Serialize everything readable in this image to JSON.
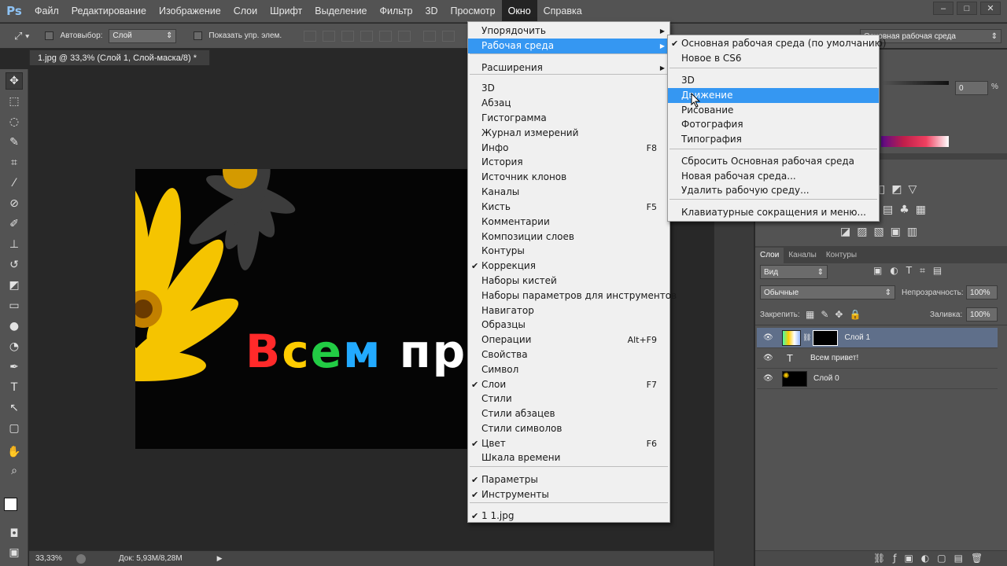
{
  "app": {
    "logo": "Ps"
  },
  "menubar": [
    "Файл",
    "Редактирование",
    "Изображение",
    "Слои",
    "Шрифт",
    "Выделение",
    "Фильтр",
    "3D",
    "Просмотр",
    "Окно",
    "Справка"
  ],
  "window_controls": [
    "–",
    "□",
    "✕"
  ],
  "options": {
    "autoselect_label": "Автовыбор:",
    "autoselect_value": "Слой",
    "show_controls_label": "Показать упр. элем.",
    "workspace_value": "Основная рабочая среда"
  },
  "document": {
    "tab_title": "1.jpg @ 33,3% (Слой 1, Слой-маска/8) *",
    "canvas_text": "Всем при",
    "zoom": "33,33%",
    "doc_size": "Док: 5,93M/8,28M"
  },
  "window_menu": {
    "items": [
      {
        "label": "Упорядочить",
        "submenu": true
      },
      {
        "label": "Рабочая среда",
        "submenu": true,
        "highlighted": true
      },
      {
        "label": "Расширения",
        "submenu": true
      },
      {
        "label": "3D"
      },
      {
        "label": "Абзац"
      },
      {
        "label": "Гистограмма"
      },
      {
        "label": "Журнал измерений"
      },
      {
        "label": "Инфо",
        "shortcut": "F8"
      },
      {
        "label": "История"
      },
      {
        "label": "Источник клонов"
      },
      {
        "label": "Каналы"
      },
      {
        "label": "Кисть",
        "shortcut": "F5"
      },
      {
        "label": "Комментарии"
      },
      {
        "label": "Композиции слоев"
      },
      {
        "label": "Контуры"
      },
      {
        "label": "Коррекция",
        "checked": true
      },
      {
        "label": "Наборы кистей"
      },
      {
        "label": "Наборы параметров для инструментов"
      },
      {
        "label": "Навигатор"
      },
      {
        "label": "Образцы"
      },
      {
        "label": "Операции",
        "shortcut": "Alt+F9"
      },
      {
        "label": "Свойства"
      },
      {
        "label": "Символ"
      },
      {
        "label": "Слои",
        "shortcut": "F7",
        "checked": true
      },
      {
        "label": "Стили"
      },
      {
        "label": "Стили абзацев"
      },
      {
        "label": "Стили символов"
      },
      {
        "label": "Цвет",
        "shortcut": "F6",
        "checked": true
      },
      {
        "label": "Шкала времени"
      },
      {
        "label": "Параметры",
        "checked": true
      },
      {
        "label": "Инструменты",
        "checked": true
      },
      {
        "label": "1 1.jpg",
        "checked": true
      }
    ]
  },
  "workspace_submenu": {
    "items": [
      {
        "label": "Основная рабочая среда (по умолчанию)",
        "checked": true
      },
      {
        "label": "Новое в CS6"
      },
      {
        "label": "3D"
      },
      {
        "label": "Движение",
        "highlighted": true
      },
      {
        "label": "Рисование"
      },
      {
        "label": "Фотография"
      },
      {
        "label": "Типография"
      },
      {
        "label": "Сбросить Основная рабочая среда"
      },
      {
        "label": "Новая рабочая среда..."
      },
      {
        "label": "Удалить рабочую среду..."
      },
      {
        "label": "Клавиатурные сокращения и меню..."
      }
    ]
  },
  "panels": {
    "opacity_value": "0",
    "percent": "%",
    "layer_tabs": [
      "Слои",
      "Каналы",
      "Контуры"
    ],
    "filter_kind": "Вид",
    "blend_mode": "Обычные",
    "opacity_label": "Непрозрачность:",
    "opacity": "100%",
    "lock_label": "Закрепить:",
    "fill_label": "Заливка:",
    "fill": "100%",
    "layers": [
      {
        "name": "Слой 1",
        "selected": true
      },
      {
        "name": "Всем привет!",
        "type": "text"
      },
      {
        "name": "Слой 0"
      }
    ]
  },
  "colors": {
    "highlight": "#3597f2",
    "menu_bg": "#f0f0f0",
    "chrome": "#535353",
    "flower": "#f5c400"
  }
}
